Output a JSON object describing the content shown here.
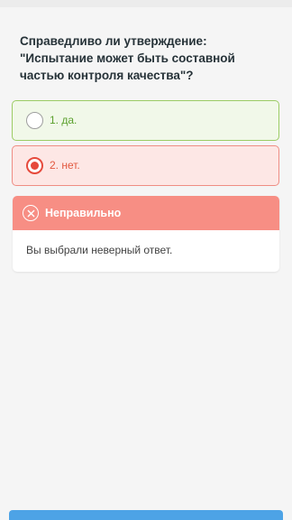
{
  "question": {
    "text": "Справедливо ли утверждение: \"Испытание может быть составной частью контроля качества\"?"
  },
  "options": [
    {
      "label": "1. да.",
      "state": "correct",
      "selected": false
    },
    {
      "label": "2. нет.",
      "state": "wrong",
      "selected": true
    }
  ],
  "feedback": {
    "title": "Неправильно",
    "message": "Вы выбрали неверный ответ."
  },
  "colors": {
    "correct": "#5aa02c",
    "wrong": "#e64a3c",
    "feedback_header": "#f78e84",
    "action_button": "#4da3e6"
  },
  "icons": {
    "feedback": "close-circle-icon"
  }
}
